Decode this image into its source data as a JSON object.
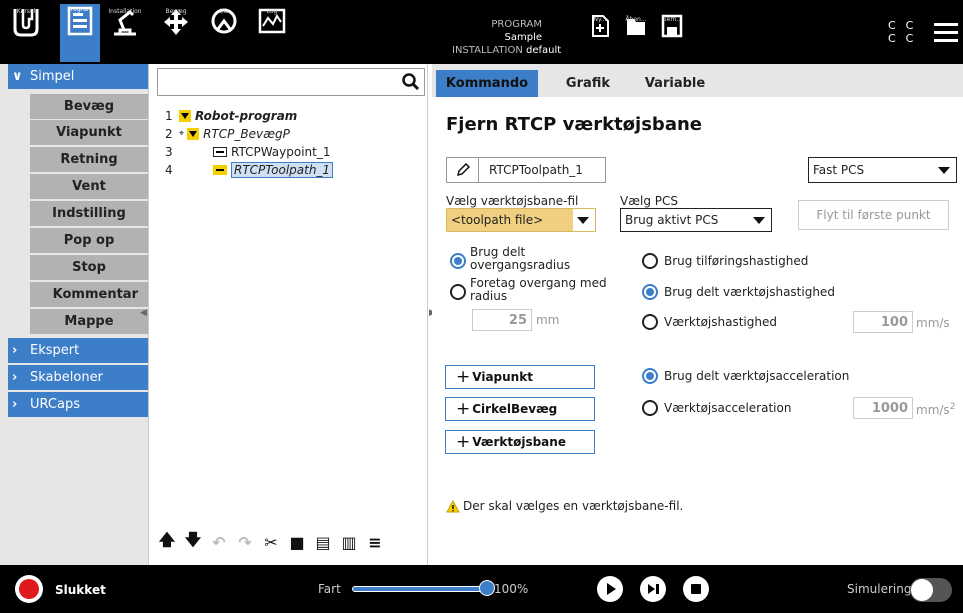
{
  "topbar": {
    "logo": "UR",
    "tabs": [
      {
        "label": "Kørsel",
        "icon": "ur-logo-icon"
      },
      {
        "label": "Program",
        "icon": "program-icon"
      },
      {
        "label": "Installation",
        "icon": "installation-icon"
      },
      {
        "label": "Bevæg",
        "icon": "move-icon"
      },
      {
        "label": "I/O",
        "icon": "io-icon"
      },
      {
        "label": "Log",
        "icon": "log-icon"
      }
    ],
    "program_label": "PROGRAM",
    "program_name": "Sample",
    "installation_label": "INSTALLATION",
    "installation_name": "default",
    "file_buttons": [
      {
        "label": "Ny...",
        "icon": "new-file-icon"
      },
      {
        "label": "Åben...",
        "icon": "folder-icon"
      },
      {
        "label": "Gem...",
        "icon": "save-icon"
      }
    ],
    "cc_lines": [
      "C  C",
      "C  C"
    ],
    "menu_icon": "hamburger-menu-icon"
  },
  "leftnav": {
    "simple_header": "Simpel",
    "items": [
      "Bevæg",
      "Viapunkt",
      "Retning",
      "Vent",
      "Indstilling",
      "Pop op",
      "Stop",
      "Kommentar",
      "Mappe"
    ],
    "sections": [
      "Ekspert",
      "Skabeloner",
      "URCaps"
    ]
  },
  "tree": {
    "rows": [
      {
        "num": "1",
        "label": "Robot-program"
      },
      {
        "num": "2",
        "label": "RTCP_BevægP"
      },
      {
        "num": "3",
        "label": "RTCPWaypoint_1"
      },
      {
        "num": "4",
        "label": "RTCPToolpath_1"
      }
    ]
  },
  "main": {
    "tabs": [
      "Kommando",
      "Grafik",
      "Variable"
    ],
    "title": "Fjern RTCP værktøjsbane",
    "node_name": "RTCPToolpath_1",
    "pcs_select": "Fast PCS",
    "toolpath_file_label": "Vælg værktøjsbane-fil",
    "toolpath_file_value": "<toolpath file>",
    "pcs_label": "Vælg PCS",
    "pcs_value": "Brug aktivt PCS",
    "move_first_button": "Flyt til første punkt",
    "blend_shared_line1": "Brug delt",
    "blend_shared_line2": "overgangsradius",
    "blend_radius_line1": "Foretag overgang med",
    "blend_radius_line2": "radius",
    "blend_value": "25",
    "blend_unit": "mm",
    "feed_speed": "Brug tilføringshastighed",
    "shared_tool_speed": "Brug delt værktøjshastighed",
    "tool_speed": "Værktøjshastighed",
    "tool_speed_value": "100",
    "tool_speed_unit": "mm/s",
    "add_waypoint": "Viapunkt",
    "add_circle": "CirkelBevæg",
    "add_toolpath": "Værktøjsbane",
    "shared_accel": "Brug delt værktøjsacceleration",
    "tool_accel": "Værktøjsacceleration",
    "tool_accel_value": "1000",
    "tool_accel_unit": "mm/s",
    "tool_accel_exp": "2",
    "warning": "Der skal vælges en værktøjsbane-fil."
  },
  "bottombar": {
    "power_status": "Slukket",
    "speed_label": "Fart",
    "speed_value": "100%",
    "speed_fraction": 1.0,
    "simulation_label": "Simulering"
  },
  "colors": {
    "accent": "#3d7ec8",
    "warning_field": "#f0d080",
    "yellow": "#f5d000"
  }
}
